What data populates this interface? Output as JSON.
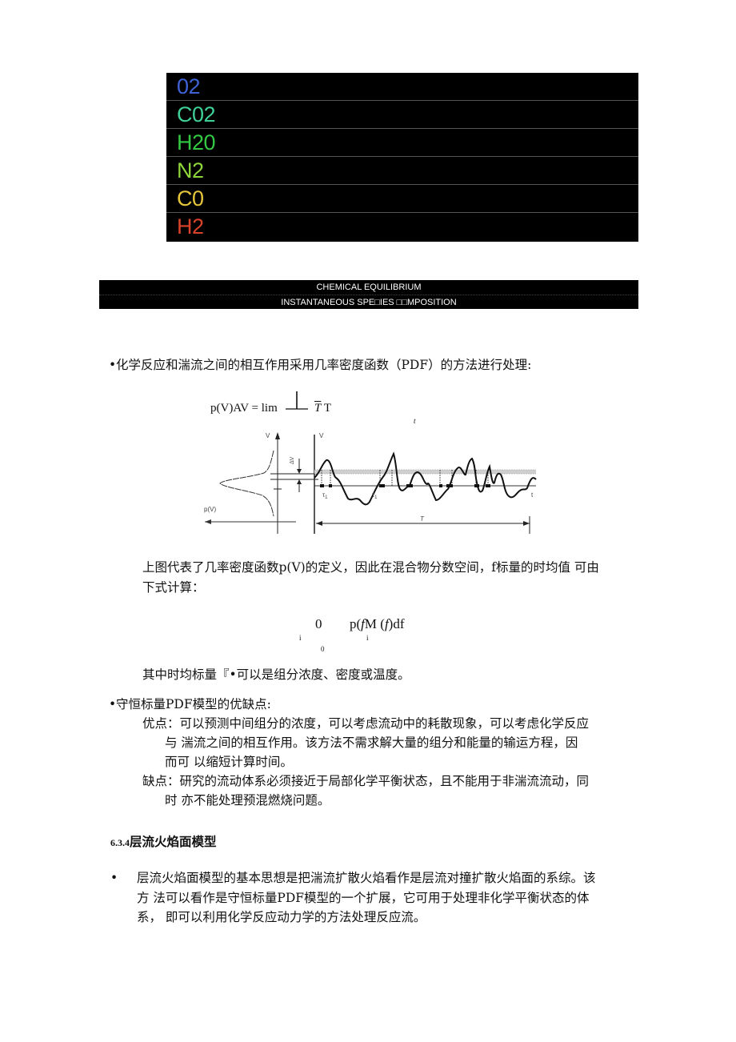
{
  "legend": {
    "items": [
      {
        "label": "02",
        "color": "#3f63d6"
      },
      {
        "label": "C02",
        "color": "#3fcf97"
      },
      {
        "label": "H20",
        "color": "#33c844"
      },
      {
        "label": "N2",
        "color": "#8ed63a"
      },
      {
        "label": "C0",
        "color": "#e7c53a"
      },
      {
        "label": "H2",
        "color": "#d8432a"
      }
    ]
  },
  "banner": {
    "line1": "CHEMICAL EQUILIBRIUM",
    "line2": "INSTANTANEOUS SPE□IES □□MPOSITION"
  },
  "section1": {
    "bullet": "•",
    "text": "化学反应和湍流之间的相互作用采用几率密度函数（PDF）的方法进行处理:"
  },
  "formula1": {
    "lhs": "p(V)AV = lim",
    "rhs_symbol": "T",
    "rhs_T": "T",
    "subscript": "t"
  },
  "figure": {
    "left_axis_label": "V",
    "right_axis_label": "V",
    "delta_label": "ΔV",
    "pdf_label": "p(V)",
    "tau_label": "τ",
    "tau_sub": "1",
    "t_label": "t",
    "T_label": "T"
  },
  "paragraph2": {
    "line1": "上图代表了几率密度函数p(V)的定义，因此在混合物分数空间，f标量的时均值  可由",
    "line2": "下式计算："
  },
  "formula2": {
    "integral_upper": "0",
    "left_sub": "i",
    "lower": "0",
    "expr_p": "p(",
    "expr_f1": "f",
    "expr_M": "M (",
    "expr_f2": "f",
    "expr_end": ")df",
    "sub_i": "i"
  },
  "paragraph3": "其中时均标量『•可以是组分浓度、密度或温度。",
  "section2": {
    "bullet": "•",
    "title": "守恒标量PDF模型的优缺点:",
    "pros_line1": "优点：可以预测中间组分的浓度，可以考虑流动中的耗散现象，可以考虑化学反应",
    "pros_line2": "与  湍流之间的相互作用。该方法不需求解大量的组分和能量的输运方程，因",
    "pros_line3": "而可  以缩短计算时间。",
    "cons_line1": "缺点：研究的流动体系必须接近于局部化学平衡状态，且不能用于非湍流流动，同",
    "cons_line2": "时  亦不能处理预混燃烧问题。"
  },
  "heading": {
    "number": "6.3.4",
    "title": "层流火焰面模型"
  },
  "section3": {
    "bullet": "•",
    "line1": "层流火焰面模型的基本思想是把湍流扩散火焰看作是层流对撞扩散火焰面的系综。该",
    "line2": "方  法可以看作是守恒标量PDF模型的一个扩展，它可用于处理非化学平衡状态的体",
    "line3": "系，  即可以利用化学反应动力学的方法处理反应流。"
  }
}
